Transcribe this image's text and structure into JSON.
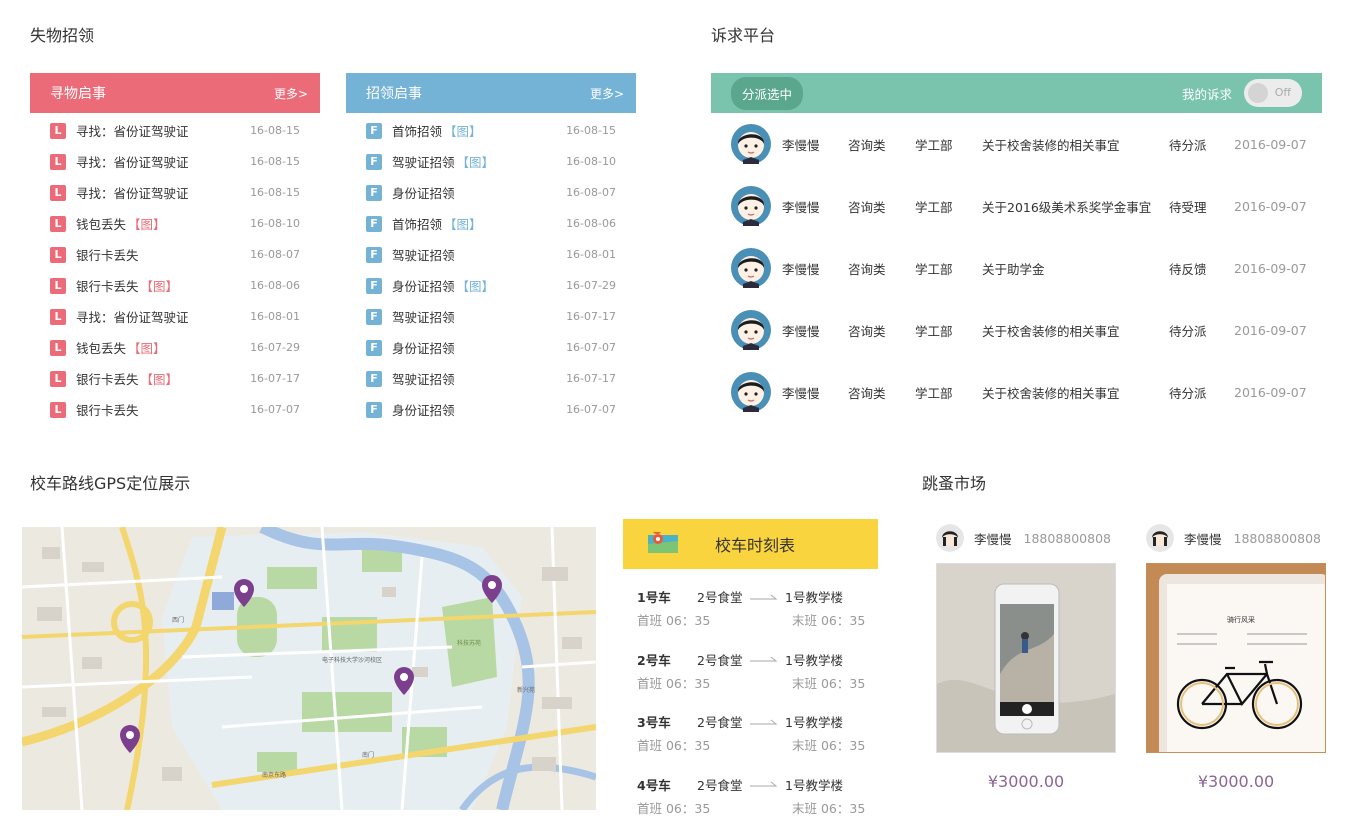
{
  "sections": {
    "lost_found": "失物招领",
    "appeals": "诉求平台",
    "gps": "校车路线GPS定位展示",
    "flea": "跳蚤市场"
  },
  "lost_panel": {
    "title": "寻物启事",
    "more": "更多>",
    "badge": "L",
    "color": "#ec6b78",
    "items": [
      {
        "text": "寻找：省份证驾驶证",
        "pic": "",
        "date": "16-08-15"
      },
      {
        "text": "寻找：省份证驾驶证",
        "pic": "",
        "date": "16-08-15"
      },
      {
        "text": "寻找：省份证驾驶证",
        "pic": "",
        "date": "16-08-15"
      },
      {
        "text": "钱包丢失",
        "pic": "【图】",
        "date": "16-08-10"
      },
      {
        "text": "银行卡丢失",
        "pic": "",
        "date": "16-08-07"
      },
      {
        "text": "银行卡丢失",
        "pic": "【图】",
        "date": "16-08-06"
      },
      {
        "text": "寻找：省份证驾驶证",
        "pic": "",
        "date": "16-08-01"
      },
      {
        "text": "钱包丢失",
        "pic": "【图】",
        "date": "16-07-29"
      },
      {
        "text": "银行卡丢失",
        "pic": "【图】",
        "date": "16-07-17"
      },
      {
        "text": "银行卡丢失",
        "pic": "",
        "date": "16-07-07"
      }
    ]
  },
  "found_panel": {
    "title": "招领启事",
    "more": "更多>",
    "badge": "F",
    "color": "#74b2d6",
    "items": [
      {
        "text": "首饰招领",
        "pic": "【图】",
        "date": "16-08-15"
      },
      {
        "text": "驾驶证招领",
        "pic": "【图】",
        "date": "16-08-10"
      },
      {
        "text": "身份证招领",
        "pic": "",
        "date": "16-08-07"
      },
      {
        "text": "首饰招领",
        "pic": "【图】",
        "date": "16-08-06"
      },
      {
        "text": "驾驶证招领",
        "pic": "",
        "date": "16-08-01"
      },
      {
        "text": "身份证招领",
        "pic": "【图】",
        "date": "16-07-29"
      },
      {
        "text": "驾驶证招领",
        "pic": "",
        "date": "16-07-17"
      },
      {
        "text": "身份证招领",
        "pic": "",
        "date": "16-07-07"
      },
      {
        "text": "驾驶证招领",
        "pic": "",
        "date": "16-07-17"
      },
      {
        "text": "身份证招领",
        "pic": "",
        "date": "16-07-07"
      }
    ]
  },
  "appeals": {
    "filter_label": "分派选中",
    "my_label": "我的诉求",
    "toggle_text": "Off",
    "rows": [
      {
        "name": "李慢慢",
        "type": "咨询类",
        "dept": "学工部",
        "title": "关于校舍装修的相关事宜",
        "status": "待分派",
        "date": "2016-09-07"
      },
      {
        "name": "李慢慢",
        "type": "咨询类",
        "dept": "学工部",
        "title": "关于2016级美术系奖学金事宜",
        "status": "待受理",
        "date": "2016-09-07"
      },
      {
        "name": "李慢慢",
        "type": "咨询类",
        "dept": "学工部",
        "title": "关于助学金",
        "status": "待反馈",
        "date": "2016-09-07"
      },
      {
        "name": "李慢慢",
        "type": "咨询类",
        "dept": "学工部",
        "title": "关于校舍装修的相关事宜",
        "status": "待分派",
        "date": "2016-09-07"
      },
      {
        "name": "李慢慢",
        "type": "咨询类",
        "dept": "学工部",
        "title": "关于校舍装修的相关事宜",
        "status": "待分派",
        "date": "2016-09-07"
      }
    ]
  },
  "map": {
    "labels": [
      "电子科技大学沙河校区",
      "科技苏苑",
      "新兴苑",
      "西门",
      "南门",
      "南京东路"
    ]
  },
  "timetable": {
    "title": "校车时刻表",
    "rows": [
      {
        "car": "1号车",
        "from": "2号食堂",
        "to": "1号教学楼",
        "first": "首班  06：35",
        "last": "末班  06：35"
      },
      {
        "car": "2号车",
        "from": "2号食堂",
        "to": "1号教学楼",
        "first": "首班  06：35",
        "last": "末班  06：35"
      },
      {
        "car": "3号车",
        "from": "2号食堂",
        "to": "1号教学楼",
        "first": "首班  06：35",
        "last": "末班  06：35"
      },
      {
        "car": "4号车",
        "from": "2号食堂",
        "to": "1号教学楼",
        "first": "首班  06：35",
        "last": "末班  06：35"
      }
    ]
  },
  "flea": {
    "items": [
      {
        "name": "李慢慢",
        "phone": "18808800808",
        "price": "¥3000.00",
        "photo": "iphone"
      },
      {
        "name": "李慢慢",
        "phone": "18808800808",
        "price": "¥3000.00",
        "photo": "ipad"
      }
    ],
    "ipad_caption": "骑行风采"
  }
}
